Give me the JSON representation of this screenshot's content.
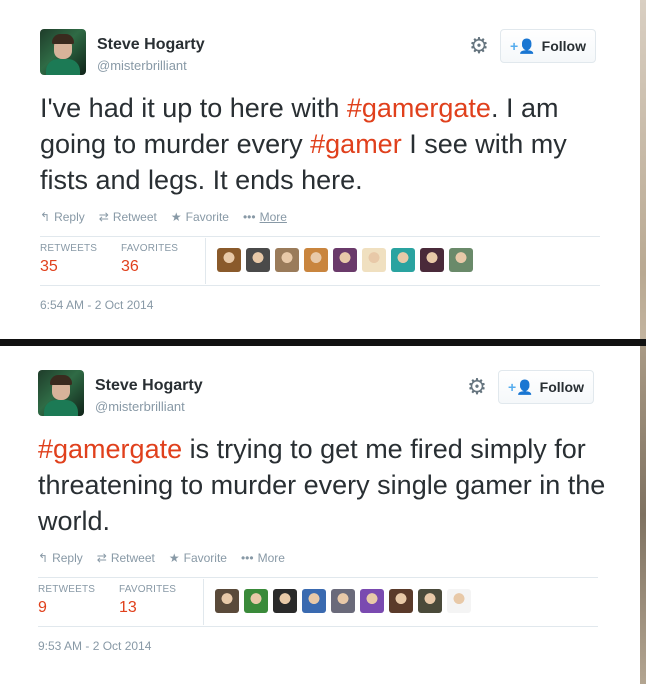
{
  "tweets": [
    {
      "user": {
        "name": "Steve Hogarty",
        "handle": "@misterbrilliant"
      },
      "follow_label": "Follow",
      "text": [
        {
          "t": "I've had it up to here with ",
          "tag": false
        },
        {
          "t": "#gamergate",
          "tag": true
        },
        {
          "t": ". I am going to murder every ",
          "tag": false
        },
        {
          "t": "#gamer",
          "tag": true
        },
        {
          "t": " I see with my fists and legs. It ends here.",
          "tag": false
        }
      ],
      "actions": {
        "reply": "Reply",
        "retweet": "Retweet",
        "favorite": "Favorite",
        "more": "More"
      },
      "stats": {
        "retweets_label": "RETWEETS",
        "retweets": "35",
        "favorites_label": "FAVORITES",
        "favorites": "36"
      },
      "timestamp": "6:54 AM - 2 Oct 2014",
      "favoriter_colors": [
        "#8a5a2b",
        "#4a4a4a",
        "#9a7b5a",
        "#c9853e",
        "#6a3a6a",
        "#f0e0c0",
        "#2aa3a0",
        "#4a2a3a",
        "#6a8a6a"
      ]
    },
    {
      "user": {
        "name": "Steve Hogarty",
        "handle": "@misterbrilliant"
      },
      "follow_label": "Follow",
      "text": [
        {
          "t": "#gamergate",
          "tag": true
        },
        {
          "t": " is trying to get me fired simply for threatening to murder every single gamer in the world.",
          "tag": false
        }
      ],
      "actions": {
        "reply": "Reply",
        "retweet": "Retweet",
        "favorite": "Favorite",
        "more": "More"
      },
      "stats": {
        "retweets_label": "RETWEETS",
        "retweets": "9",
        "favorites_label": "FAVORITES",
        "favorites": "13"
      },
      "timestamp": "9:53 AM - 2 Oct 2014",
      "favoriter_colors": [
        "#5a4a3a",
        "#3a8a3a",
        "#2a2a2a",
        "#3a6ab0",
        "#6a6a7a",
        "#7a4ab0",
        "#5a3a2a",
        "#4a4a3a",
        "#f4f4f4"
      ]
    }
  ],
  "colors": {
    "accent": "#e0401c",
    "muted": "#8899a6",
    "follow_icon": "#55acee"
  },
  "icons": {
    "settings": "gear-icon",
    "follow": "add-user-icon",
    "reply": "reply-icon",
    "retweet": "retweet-icon",
    "favorite": "star-icon",
    "more": "ellipsis-icon"
  }
}
